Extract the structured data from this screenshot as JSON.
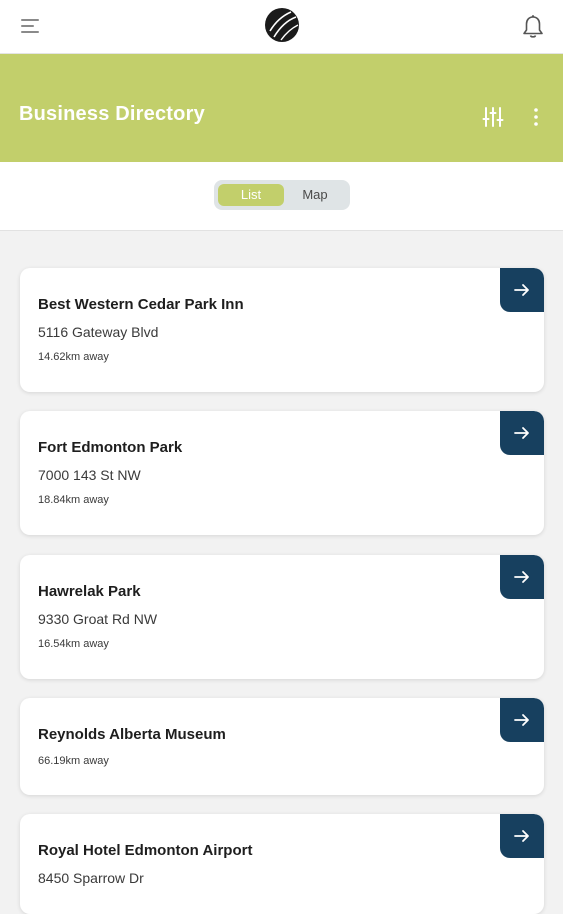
{
  "topbar": {
    "menu_icon": "hamburger-menu-icon",
    "logo_icon": "round-logo-icon",
    "notification_icon": "bell-icon"
  },
  "header": {
    "title": "Business Directory",
    "filter_icon": "sliders-icon",
    "more_icon": "vertical-dots-icon",
    "background_color": "#c2cf6b"
  },
  "view_toggle": {
    "list_label": "List",
    "map_label": "Map",
    "selected": "List"
  },
  "businesses": [
    {
      "name": "Best Western Cedar Park Inn",
      "address": "5116 Gateway Blvd",
      "distance": "14.62km away"
    },
    {
      "name": "Fort Edmonton Park",
      "address": "7000 143 St NW",
      "distance": "18.84km away"
    },
    {
      "name": "Hawrelak Park",
      "address": "9330 Groat Rd NW",
      "distance": "16.54km away"
    },
    {
      "name": "Reynolds Alberta Museum",
      "address": "",
      "distance": "66.19km away"
    },
    {
      "name": "Royal Hotel Edmonton Airport",
      "address": "8450 Sparrow Dr",
      "distance": ""
    }
  ],
  "colors": {
    "accent": "#c2cf6b",
    "action_button": "#17405f"
  }
}
